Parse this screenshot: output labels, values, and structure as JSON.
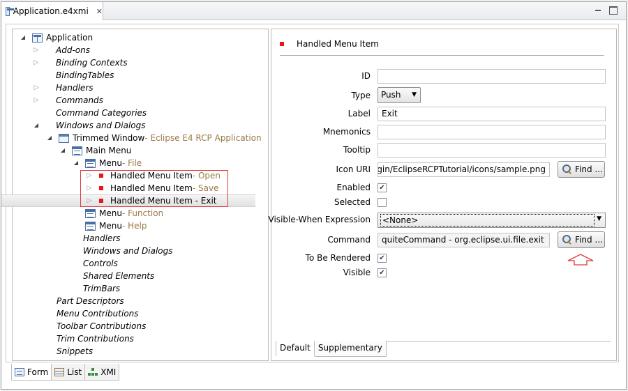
{
  "window": {
    "tab_title": "Application.e4xmi"
  },
  "tree": {
    "rows": [
      {
        "label": "Application",
        "suffix": "",
        "italic": false
      },
      {
        "label": "Add-ons",
        "suffix": "",
        "italic": true
      },
      {
        "label": "Binding Contexts",
        "suffix": "",
        "italic": true
      },
      {
        "label": "BindingTables",
        "suffix": "",
        "italic": true
      },
      {
        "label": "Handlers",
        "suffix": "",
        "italic": true
      },
      {
        "label": "Commands",
        "suffix": "",
        "italic": true
      },
      {
        "label": "Command Categories",
        "suffix": "",
        "italic": true
      },
      {
        "label": "Windows and Dialogs",
        "suffix": "",
        "italic": true
      },
      {
        "label": "Trimmed Window",
        "suffix": " - Eclipse E4 RCP Application",
        "italic": false
      },
      {
        "label": "Main Menu",
        "suffix": "",
        "italic": false
      },
      {
        "label": "Menu",
        "suffix": " - File",
        "italic": false
      },
      {
        "label": "Handled Menu Item",
        "suffix": " - Open",
        "italic": false
      },
      {
        "label": "Handled Menu Item",
        "suffix": " - Save",
        "italic": false
      },
      {
        "label": "Handled Menu Item - Exit",
        "suffix": "",
        "italic": false
      },
      {
        "label": "Menu",
        "suffix": " - Function",
        "italic": false
      },
      {
        "label": "Menu",
        "suffix": " - Help",
        "italic": false
      },
      {
        "label": "Handlers",
        "suffix": "",
        "italic": true
      },
      {
        "label": "Windows and Dialogs",
        "suffix": "",
        "italic": true
      },
      {
        "label": "Controls",
        "suffix": "",
        "italic": true
      },
      {
        "label": "Shared Elements",
        "suffix": "",
        "italic": true
      },
      {
        "label": "TrimBars",
        "suffix": "",
        "italic": true
      },
      {
        "label": "Part Descriptors",
        "suffix": "",
        "italic": true
      },
      {
        "label": "Menu Contributions",
        "suffix": "",
        "italic": true
      },
      {
        "label": "Toolbar Contributions",
        "suffix": "",
        "italic": true
      },
      {
        "label": "Trim Contributions",
        "suffix": "",
        "italic": true
      },
      {
        "label": "Snippets",
        "suffix": "",
        "italic": true
      }
    ]
  },
  "form": {
    "header": "Handled Menu Item",
    "labels": {
      "id": "ID",
      "type": "Type",
      "label": "Label",
      "mnemonics": "Mnemonics",
      "tooltip": "Tooltip",
      "icon_uri": "Icon URI",
      "enabled": "Enabled",
      "selected": "Selected",
      "visible_when": "Visible-When Expression",
      "command": "Command",
      "to_be_rendered": "To Be Rendered",
      "visible": "Visible"
    },
    "values": {
      "id": "",
      "type": "Push",
      "label": "Exit",
      "mnemonics": "",
      "tooltip": "",
      "icon_uri": "platform:/plugin/EclipseRCPTutorial/icons/sample.png",
      "visible_when": "<None>",
      "command": "quiteCommand - org.eclipse.ui.file.exit"
    },
    "checks": {
      "enabled": true,
      "selected": false,
      "to_be_rendered": true,
      "visible": true
    },
    "find_label": "Find ...",
    "bottom_tabs": [
      "Default",
      "Supplementary"
    ]
  },
  "editor_tabs": [
    "Form",
    "List",
    "XMI"
  ],
  "colors": {
    "highlight": "#e0393e",
    "suffix": "#9b7a44",
    "marker": "#e8151b"
  }
}
